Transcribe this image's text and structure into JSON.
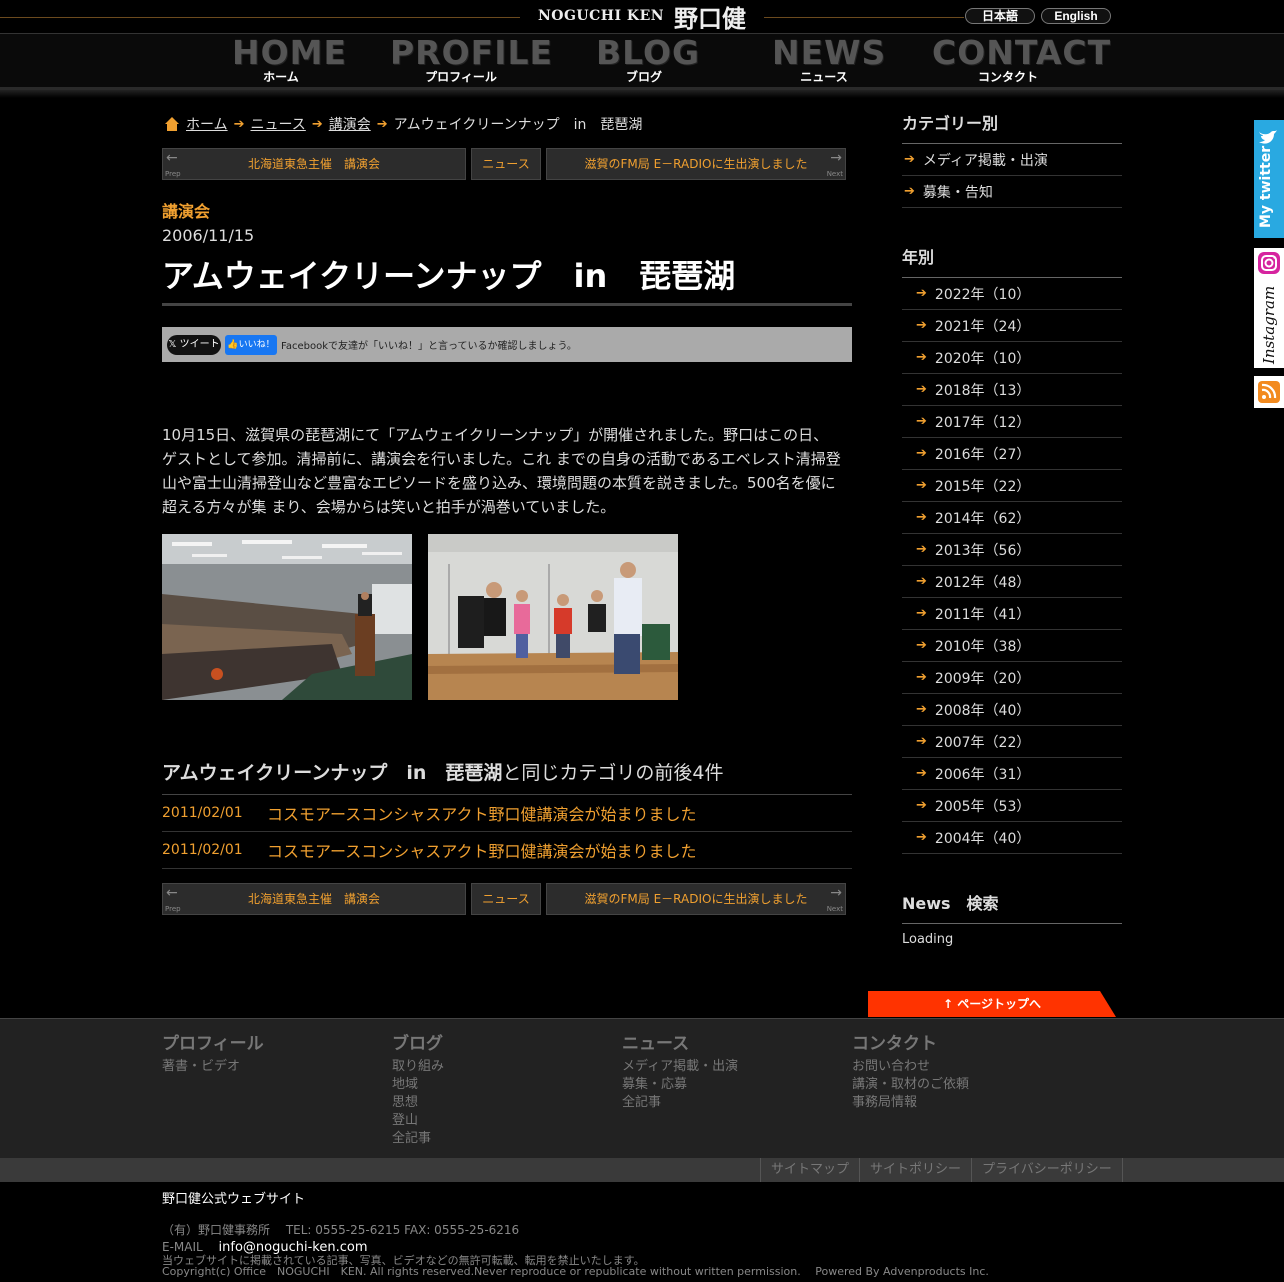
{
  "colors": {
    "accent": "#f0a030",
    "pagetop": "#ff3300",
    "twitter": "#29a9e1",
    "facebook": "#1877f2"
  },
  "header": {
    "logo_en": "NOGUCHI KEN",
    "logo_jp": "野口健",
    "lang_ja": "日本語",
    "lang_en": "English"
  },
  "nav": [
    {
      "en": "HOME",
      "ja": "ホーム"
    },
    {
      "en": "PROFILE",
      "ja": "プロフィール"
    },
    {
      "en": "BLOG",
      "ja": "ブログ"
    },
    {
      "en": "NEWS",
      "ja": "ニュース"
    },
    {
      "en": "CONTACT",
      "ja": "コンタクト"
    }
  ],
  "breadcrumb": {
    "home": "ホーム",
    "news": "ニュース",
    "category": "講演会",
    "current": "アムウェイクリーンナップ　in　琵琶湖"
  },
  "pager": {
    "prev_label": "Prep",
    "prev_title": "北海道東急主催　講演会",
    "center": "ニュース",
    "next_title": "滋賀のFM局 E－RADIOに生出演しました",
    "next_label": "Next"
  },
  "article": {
    "category": "講演会",
    "date": "2006/11/15",
    "title": "アムウェイクリーンナップ　in　琵琶湖",
    "body": "10月15日、滋賀県の琵琶湖にて「アムウェイクリーンナップ」が開催されました。野口はこの日、ゲストとして参加。清掃前に、講演会を行いました。これ までの自身の活動であるエベレスト清掃登山や富士山清掃登山など豊富なエピソードを盛り込み、環境問題の本質を説きました。500名を優に超える方々が集 まり、会場からは笑いと拍手が渦巻いていました。"
  },
  "share": {
    "tweet": "ツイート",
    "fb_like": "いいね！",
    "fb_text": "Facebookで友達が「いいね！」と言っているか確認しましょう。"
  },
  "related": {
    "heading_title": "アムウェイクリーンナップ　in　琵琶湖",
    "heading_suffix": "と同じカテゴリの前後4件",
    "items": [
      {
        "date": "2011/02/01",
        "title": "コスモアースコンシャスアクト野口健講演会が始まりました"
      },
      {
        "date": "2011/02/01",
        "title": "コスモアースコンシャスアクト野口健講演会が始まりました"
      }
    ]
  },
  "sidebar": {
    "categories_heading": "カテゴリー別",
    "categories": [
      "メディア掲載・出演",
      "募集・告知"
    ],
    "years_heading": "年別",
    "years": [
      "2022年（10）",
      "2021年（24）",
      "2020年（10）",
      "2018年（13）",
      "2017年（12）",
      "2016年（27）",
      "2015年（22）",
      "2014年（62）",
      "2013年（56）",
      "2012年（48）",
      "2011年（41）",
      "2010年（38）",
      "2009年（20）",
      "2008年（40）",
      "2007年（22）",
      "2006年（31）",
      "2005年（53）",
      "2004年（40）"
    ],
    "search_heading": "News　検索",
    "loading": "Loading"
  },
  "social": {
    "twitter": "My twitter",
    "instagram": "Instagram"
  },
  "pagetop": "ページトップへ",
  "footer": {
    "cols": [
      {
        "heading": "プロフィール",
        "links": [
          "著書・ビデオ"
        ]
      },
      {
        "heading": "ブログ",
        "links": [
          "取り組み",
          "地域",
          "思想",
          "登山",
          "全記事"
        ]
      },
      {
        "heading": "ニュース",
        "links": [
          "メディア掲載・出演",
          "募集・応募",
          "全記事"
        ]
      },
      {
        "heading": "コンタクト",
        "links": [
          "お問い合わせ",
          "講演・取材のご依頼",
          "事務局情報"
        ]
      }
    ],
    "links": [
      "サイトマップ",
      "サイトポリシー",
      "プライバシーポリシー"
    ],
    "site_name": "野口健公式ウェブサイト",
    "office": "（有）野口健事務所　 TEL: 0555-25-6215 FAX: 0555-25-6216",
    "email_label": "E-MAIL",
    "email": "info@noguchi-ken.com",
    "notice": "当ウェブサイトに掲載されている記事、写真、ビデオなどの無許可転載、転用を禁止いたします。",
    "copyright": "Copyright(c) Office　NOGUCHI　KEN. All rights reserved.Never reproduce or republicate without written permission.",
    "powered": "Powered By Advenproducts Inc."
  }
}
